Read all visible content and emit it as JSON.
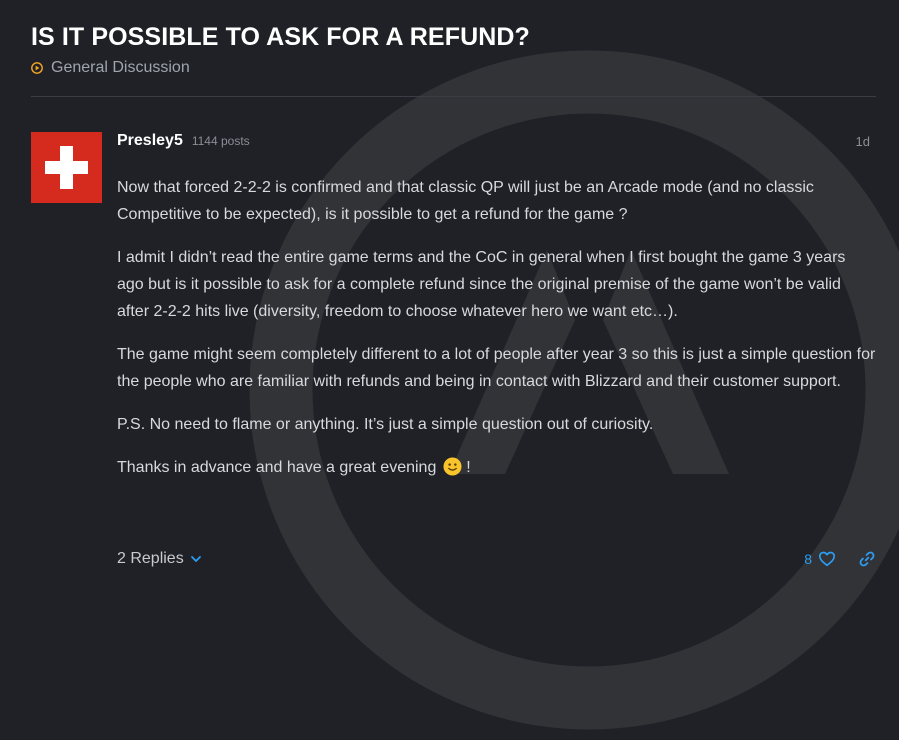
{
  "topic": {
    "title": "IS IT POSSIBLE TO ASK FOR A REFUND?",
    "category": "General Discussion"
  },
  "post": {
    "author": "Presley5",
    "post_count": "1144 posts",
    "time_ago": "1d",
    "avatar_colors": {
      "background": "#d52b1e",
      "cross": "#ffffff"
    },
    "paragraphs": [
      "Now that forced 2-2-2 is confirmed and that classic QP will just be an Arcade mode (and no classic Competitive to be expected), is it possible to get a refund for the game ?",
      "I admit I didn’t read the entire game terms and the CoC in general when I first bought the game 3 years ago but is it possible to ask for a complete refund since the original premise of the game won’t be valid after 2-2-2 hits live (diversity, freedom to choose whatever hero we want etc…).",
      "The game might seem completely different to a lot of people after year 3 so this is just a simple question for the people who are familiar with refunds and being in contact with Blizzard and their customer support.",
      "P.S. No need to flame or anything. It’s just a simple question out of curiosity."
    ],
    "closing_text_before_emoji": "Thanks in advance and have a great evening ",
    "closing_text_after_emoji": " !",
    "replies_label": "2 Replies",
    "like_count": "8"
  },
  "icons": {
    "category": "play-circle-icon",
    "emoji": "slightly-smiling-face-icon",
    "replies": "chevron-down-icon",
    "like": "heart-icon",
    "share": "link-icon"
  },
  "colors": {
    "background": "#1f2126",
    "accent": "#2e9cf0",
    "category_icon": "#f5a623"
  }
}
